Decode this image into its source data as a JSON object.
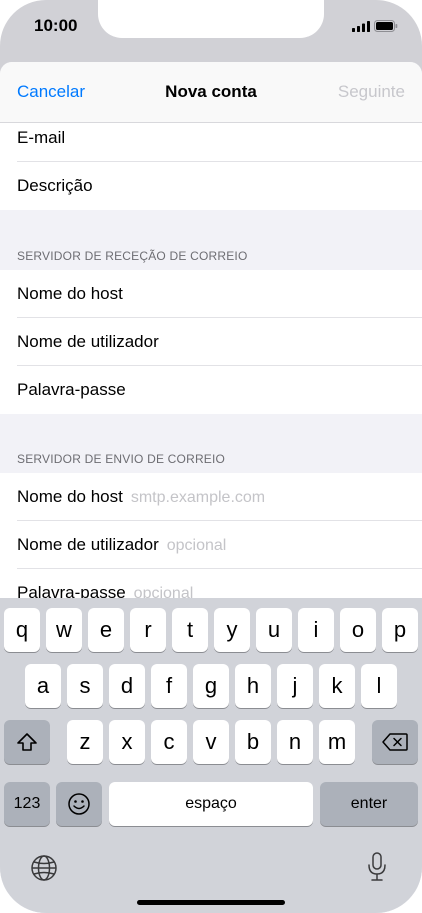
{
  "status_bar": {
    "time": "10:00"
  },
  "nav": {
    "cancel": "Cancelar",
    "title": "Nova conta",
    "next": "Seguinte"
  },
  "account_fields": [
    {
      "label": "E-mail"
    },
    {
      "label": "Descrição"
    }
  ],
  "incoming": {
    "header": "SERVIDOR DE RECEÇÃO DE CORREIO",
    "fields": [
      {
        "label": "Nome do host"
      },
      {
        "label": "Nome de utilizador"
      },
      {
        "label": "Palavra-passe"
      }
    ]
  },
  "outgoing": {
    "header": "SERVIDOR DE ENVIO DE CORREIO",
    "fields": [
      {
        "label": "Nome do host",
        "placeholder": "smtp.example.com"
      },
      {
        "label": "Nome de utilizador",
        "placeholder": "opcional"
      },
      {
        "label": "Palavra-passe",
        "placeholder": "opcional"
      }
    ]
  },
  "keyboard": {
    "row1": [
      "q",
      "w",
      "e",
      "r",
      "t",
      "y",
      "u",
      "i",
      "o",
      "p"
    ],
    "row2": [
      "a",
      "s",
      "d",
      "f",
      "g",
      "h",
      "j",
      "k",
      "l"
    ],
    "row3": [
      "z",
      "x",
      "c",
      "v",
      "b",
      "n",
      "m"
    ],
    "numbers_key": "123",
    "space_key": "espaço",
    "enter_key": "enter",
    "icons": {
      "shift": "shift-icon",
      "backspace": "backspace-icon",
      "emoji": "emoji-icon",
      "globe": "globe-icon",
      "mic": "microphone-icon"
    }
  }
}
